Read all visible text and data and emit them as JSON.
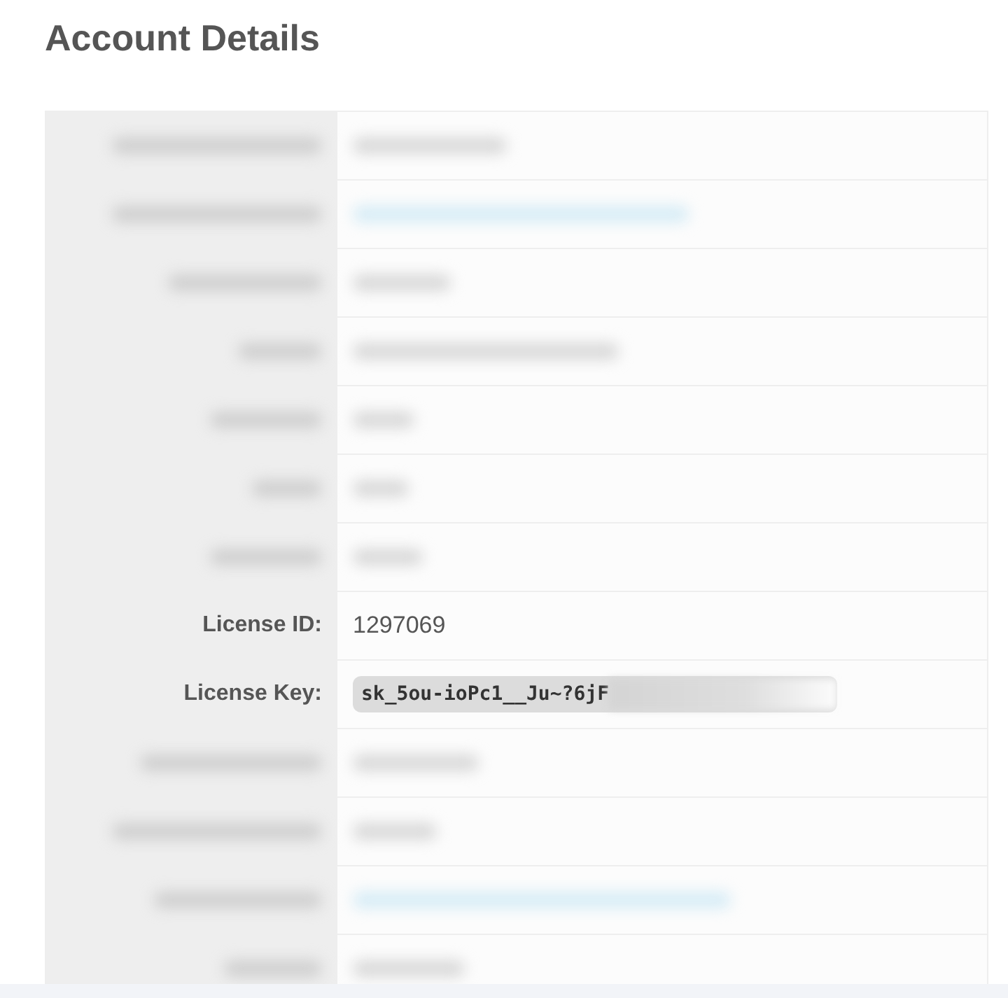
{
  "title": "Account Details",
  "rows": [
    {
      "kind": "redacted"
    },
    {
      "kind": "redacted-link"
    },
    {
      "kind": "redacted"
    },
    {
      "kind": "redacted"
    },
    {
      "kind": "redacted"
    },
    {
      "kind": "redacted"
    },
    {
      "kind": "redacted"
    },
    {
      "kind": "text",
      "label": "License ID:",
      "value": "1297069"
    },
    {
      "kind": "code",
      "label": "License Key:",
      "value": "sk_5ou-ioPc1__Ju~?6jF"
    },
    {
      "kind": "redacted"
    },
    {
      "kind": "redacted"
    },
    {
      "kind": "redacted-link"
    },
    {
      "kind": "redacted"
    }
  ]
}
